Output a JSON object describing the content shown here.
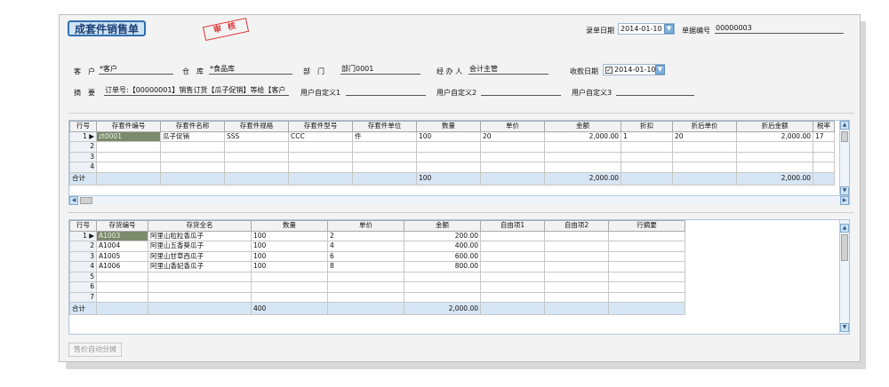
{
  "title": "成套件销售单",
  "stamp": "审 核",
  "header": {
    "entry_date_label": "录单日期",
    "entry_date": "2014-01-10",
    "doc_no_label": "单据编号",
    "doc_no": "00000003"
  },
  "form": {
    "customer_label": "客　户",
    "customer": "*客户",
    "warehouse_label": "仓　库",
    "warehouse": "*食品库",
    "dept_label": "部　门",
    "dept": "部门0001",
    "handler_label": "经 办 人",
    "handler": "会计主管",
    "receipt_date_label": "收款日期",
    "receipt_date": "2014-01-10",
    "summary_label": "摘　要",
    "summary": "订单号:【00000001】销售订货【瓜子促销】等给【客户",
    "custom1_label": "用户自定义1",
    "custom2_label": "用户自定义2",
    "custom3_label": "用户自定义3"
  },
  "grid1": {
    "headers": [
      "行号",
      "存套件编号",
      "存套件名称",
      "存套件规格",
      "存套件型号",
      "存套件单位",
      "数量",
      "单价",
      "金额",
      "折扣",
      "折后单价",
      "折后金额",
      "税率"
    ],
    "rows": [
      [
        "1",
        "zt0001",
        "瓜子促销",
        "SSS",
        "CCC",
        "件",
        "100",
        "20",
        "2,000.00",
        "1",
        "20",
        "2,000.00",
        "17"
      ],
      [
        "2",
        "",
        "",
        "",
        "",
        "",
        "",
        "",
        "",
        "",
        "",
        "",
        ""
      ],
      [
        "3",
        "",
        "",
        "",
        "",
        "",
        "",
        "",
        "",
        "",
        "",
        "",
        ""
      ],
      [
        "4",
        "",
        "",
        "",
        "",
        "",
        "",
        "",
        "",
        "",
        "",
        "",
        ""
      ]
    ],
    "total": [
      "合计",
      "",
      "",
      "",
      "",
      "",
      "100",
      "",
      "2,000.00",
      "",
      "",
      "2,000.00",
      ""
    ]
  },
  "grid2": {
    "headers": [
      "行号",
      "存货编号",
      "存货全名",
      "数量",
      "单价",
      "金额",
      "自由项1",
      "自由项2",
      "行摘要"
    ],
    "rows": [
      [
        "1",
        "A1003",
        "阿里山粒粒香瓜子",
        "100",
        "2",
        "200.00",
        "",
        "",
        ""
      ],
      [
        "2",
        "A1004",
        "阿里山五香葵瓜子",
        "100",
        "4",
        "400.00",
        "",
        "",
        ""
      ],
      [
        "3",
        "A1005",
        "阿里山甘草西瓜子",
        "100",
        "6",
        "600.00",
        "",
        "",
        ""
      ],
      [
        "4",
        "A1006",
        "阿里山香妃香瓜子",
        "100",
        "8",
        "800.00",
        "",
        "",
        ""
      ],
      [
        "5",
        "",
        "",
        "",
        "",
        "",
        "",
        "",
        ""
      ],
      [
        "6",
        "",
        "",
        "",
        "",
        "",
        "",
        "",
        ""
      ],
      [
        "7",
        "",
        "",
        "",
        "",
        "",
        "",
        "",
        ""
      ]
    ],
    "total": [
      "合计",
      "",
      "",
      "400",
      "",
      "2,000.00",
      "",
      "",
      ""
    ]
  },
  "buttons": {
    "auto_split": "售价自动分摊"
  }
}
